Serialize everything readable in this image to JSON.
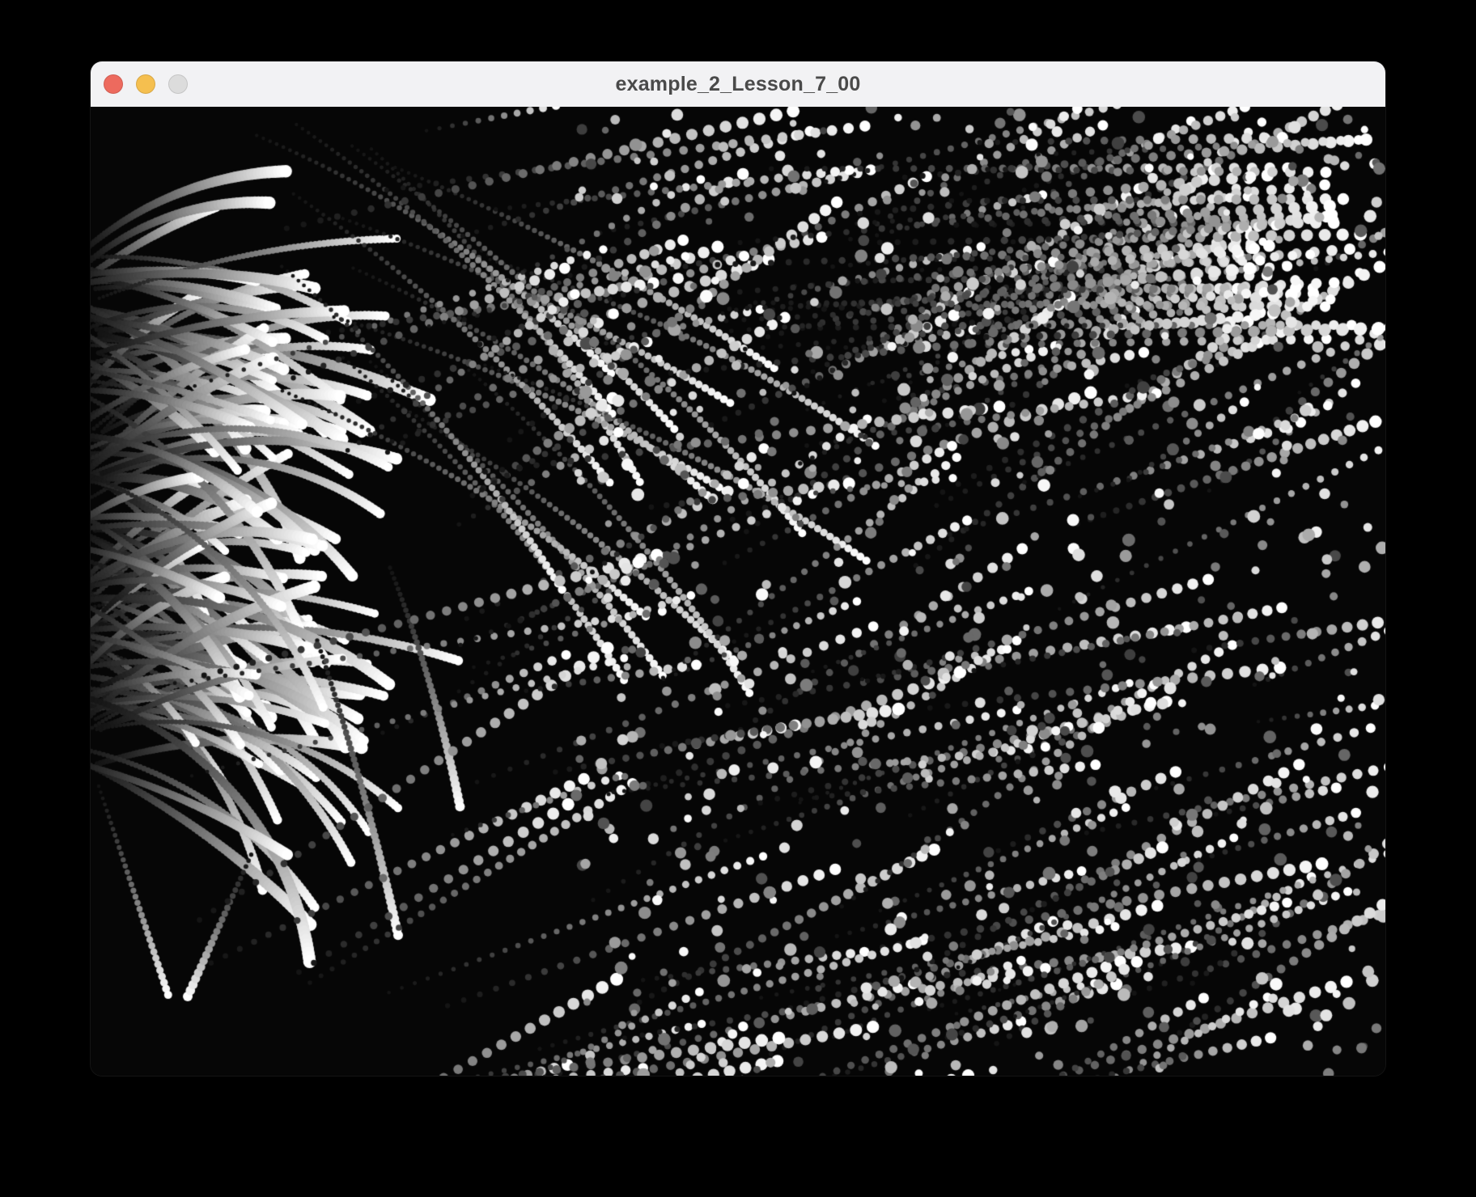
{
  "window": {
    "title": "example_2_Lesson_7_00",
    "buttons": {
      "close_color": "#ed6a5e",
      "minimize_color": "#f5bf4f",
      "zoom_color": "#dcdcdc"
    }
  },
  "sketch": {
    "background_color": "#060606",
    "particle_color": "#ffffff",
    "description_colors": [
      "#ffffff",
      "#cfcfcf",
      "#8a8a8a",
      "#3a3a3a"
    ]
  }
}
